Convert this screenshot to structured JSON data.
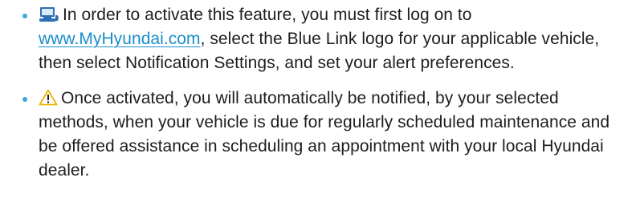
{
  "items": [
    {
      "icon": "computer-icon",
      "segments": [
        {
          "type": "text",
          "value": "In order to activate this feature, you must first log on to "
        },
        {
          "type": "link",
          "value": "www.MyHyundai.com"
        },
        {
          "type": "text",
          "value": ", select the Blue Link logo for your applicable vehicle, then select Notification Settings, and set your alert preferences."
        }
      ]
    },
    {
      "icon": "warning-icon",
      "segments": [
        {
          "type": "text",
          "value": "Once activated, you will automatically be notified, by your selected methods, when your vehicle is due for regularly scheduled maintenance and be offered assistance in scheduling an appointment with your local Hyundai dealer."
        }
      ]
    }
  ],
  "colors": {
    "bullet": "#39a9dc",
    "link": "#1a8dc9",
    "warning_outline": "#e8b400",
    "computer_icon": "#2f6fb3"
  }
}
